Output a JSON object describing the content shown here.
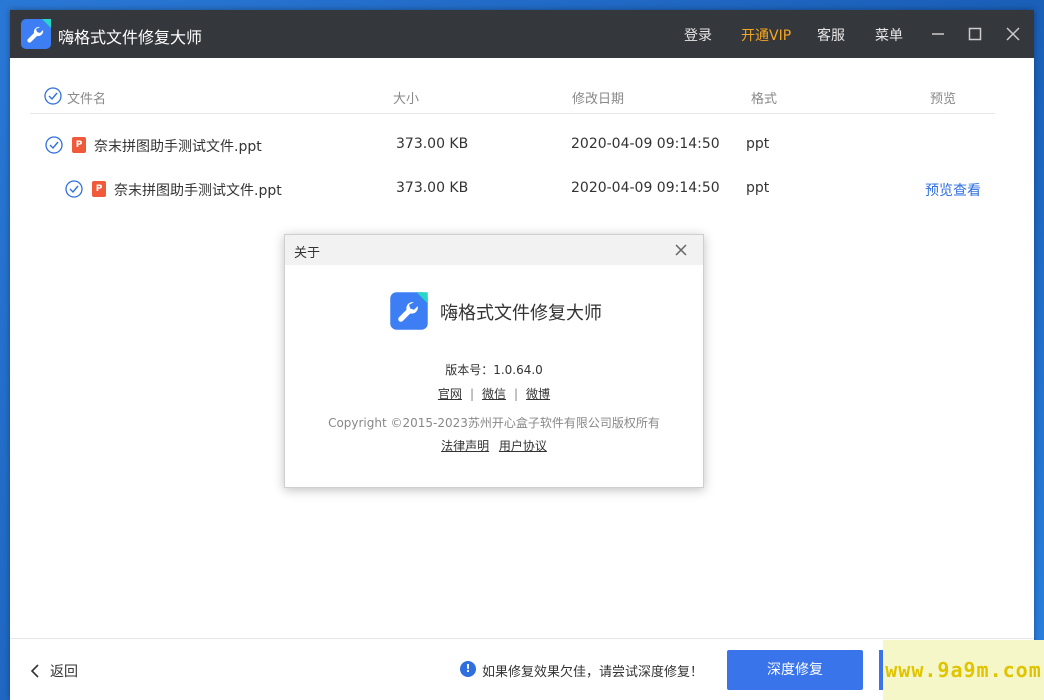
{
  "app": {
    "title": "嗨格式文件修复大师",
    "menu": {
      "login": "登录",
      "vip": "开通VIP",
      "service": "客服",
      "menu": "菜单"
    }
  },
  "table": {
    "headers": {
      "name": "文件名",
      "size": "大小",
      "date": "修改日期",
      "format": "格式",
      "preview": "预览"
    },
    "rows": [
      {
        "name": "奈末拼图助手测试文件.ppt",
        "size": "373.00 KB",
        "date": "2020-04-09 09:14:50",
        "format": "ppt",
        "preview": ""
      },
      {
        "name": "奈末拼图助手测试文件.ppt",
        "size": "373.00 KB",
        "date": "2020-04-09 09:14:50",
        "format": "ppt",
        "preview": "预览查看"
      }
    ],
    "file_icon_letter": "P"
  },
  "about_dialog": {
    "title": "关于",
    "app_name": "嗨格式文件修复大师",
    "version": "版本号：1.0.64.0",
    "links": [
      "官网",
      "微信",
      "微博"
    ],
    "copyright": "Copyright ©2015-2023苏州开心盒子软件有限公司版权所有",
    "legal": "法律声明",
    "agreement": "用户协议"
  },
  "footer": {
    "back": "返回",
    "hint": "如果修复效果欠佳，请尝试深度修复！",
    "deep_repair": "深度修复",
    "info_mark": "!"
  },
  "watermark": "www.9a9m.com",
  "colors": {
    "titlebar": "#34373c",
    "accent": "#3a74ea",
    "vip": "#f5a623",
    "ppt": "#f05a3a"
  }
}
